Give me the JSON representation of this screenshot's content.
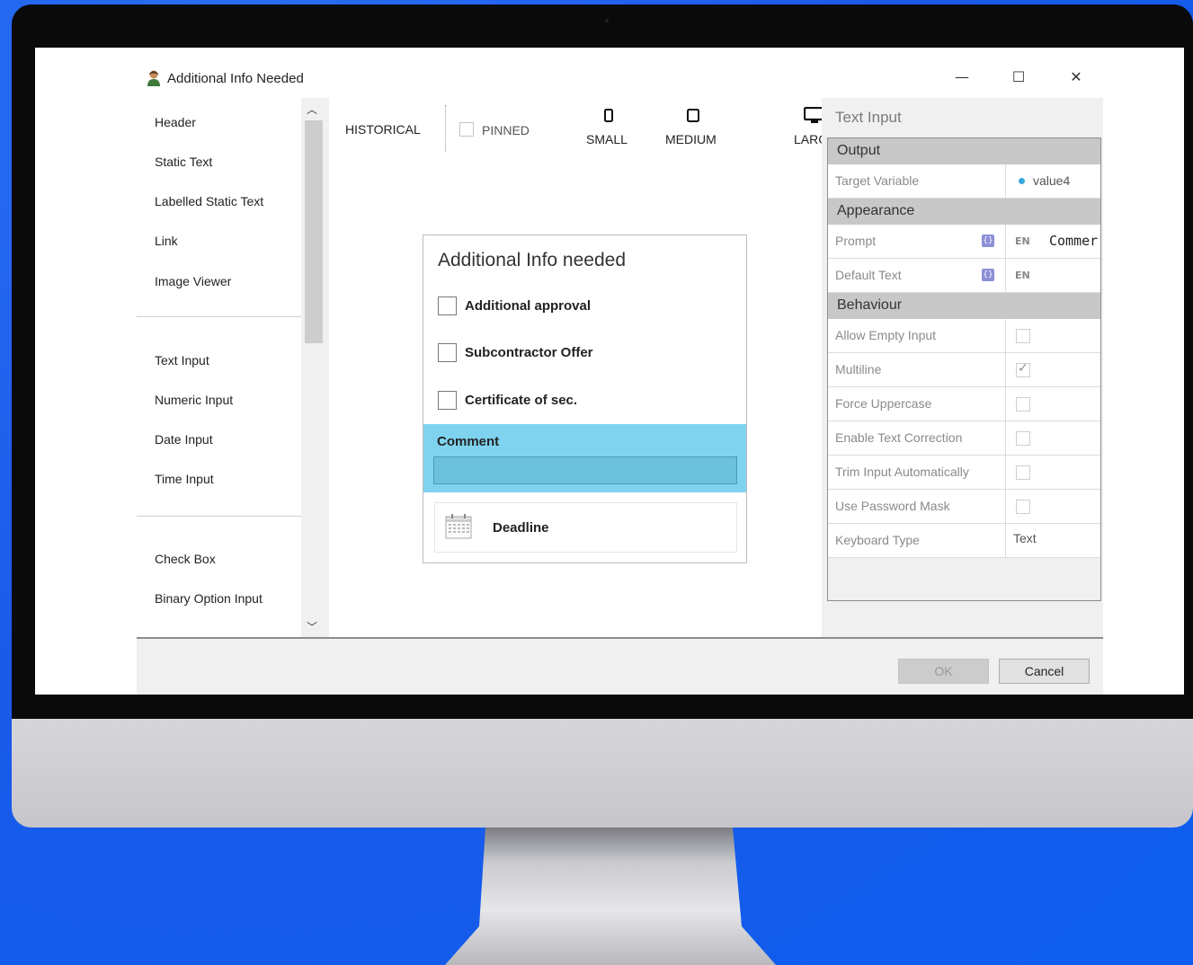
{
  "window": {
    "title": "Additional Info Needed",
    "controls": {
      "minimize": "—",
      "maximize": "☐",
      "close": "✕"
    }
  },
  "toolbox": {
    "groups": [
      [
        "Header",
        "Static Text",
        "Labelled Static Text",
        "Link",
        "Image Viewer"
      ],
      [
        "Text Input",
        "Numeric Input",
        "Date Input",
        "Time Input"
      ],
      [
        "Check Box",
        "Binary Option Input"
      ]
    ]
  },
  "toolbar": {
    "historical": "HISTORICAL",
    "pinned": "PINNED",
    "small": "SMALL",
    "medium": "MEDIUM",
    "large": "LARGE"
  },
  "form": {
    "title": "Additional Info needed",
    "checkboxes": [
      "Additional approval",
      "Subcontractor Offer",
      "Certificate of sec."
    ],
    "comment_label": "Comment",
    "deadline_label": "Deadline"
  },
  "properties": {
    "title": "Text Input",
    "sections": {
      "output": "Output",
      "appearance": "Appearance",
      "behaviour": "Behaviour"
    },
    "target_variable": {
      "name": "Target Variable",
      "value": "value4"
    },
    "prompt": {
      "name": "Prompt",
      "lang": "EN",
      "value": "Commer"
    },
    "default_text": {
      "name": "Default Text",
      "lang": "EN"
    },
    "loc_icon": "{}",
    "behaviour_rows": [
      {
        "name": "Allow Empty Input",
        "checked": false
      },
      {
        "name": "Multiline",
        "checked": true
      },
      {
        "name": "Force Uppercase",
        "checked": false
      },
      {
        "name": "Enable Text Correction",
        "checked": false
      },
      {
        "name": "Trim Input Automatically",
        "checked": false
      },
      {
        "name": "Use Password Mask",
        "checked": false
      }
    ],
    "keyboard_type": {
      "name": "Keyboard Type",
      "value": "Text"
    },
    "check_mark": "✓"
  },
  "footer": {
    "ok": "OK",
    "cancel": "Cancel"
  },
  "colors": {
    "background": "#1e63f0",
    "selection": "#7fd3ef",
    "variable_dot": "#3aa6e0"
  }
}
